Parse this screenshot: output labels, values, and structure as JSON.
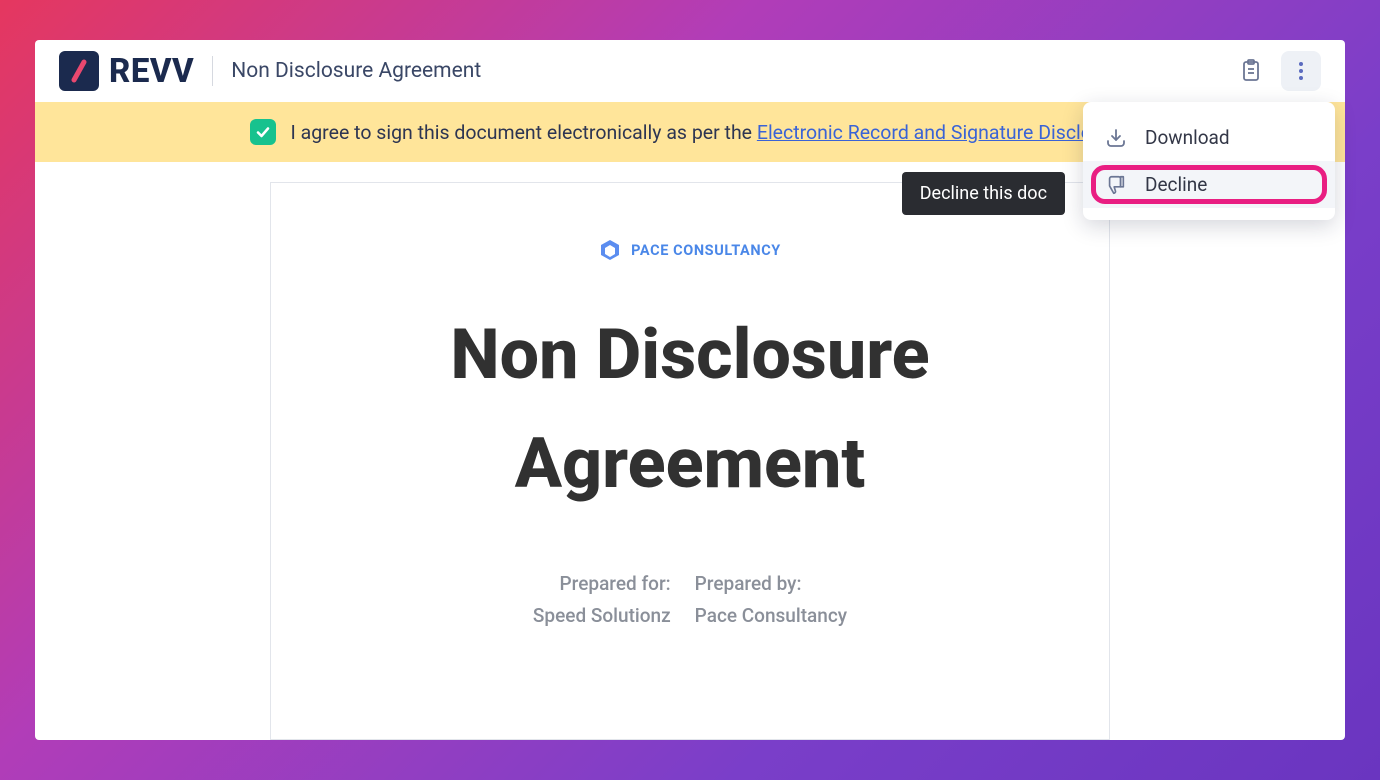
{
  "brand": "REVV",
  "doc_title": "Non Disclosure Agreement",
  "consent": {
    "checked": true,
    "text_prefix": "I agree to sign this document electronically as per the ",
    "link_text": "Electronic Record and Signature Disclosure"
  },
  "tooltip": "Decline this doc",
  "menu": {
    "download": "Download",
    "decline": "Decline"
  },
  "document": {
    "company_name": "PACE CONSULTANCY",
    "heading": "Non Disclosure Agreement",
    "prepared_for_label": "Prepared for:",
    "prepared_for_value": "Speed Solutionz",
    "prepared_by_label": "Prepared by:",
    "prepared_by_value": "Pace Consultancy"
  }
}
